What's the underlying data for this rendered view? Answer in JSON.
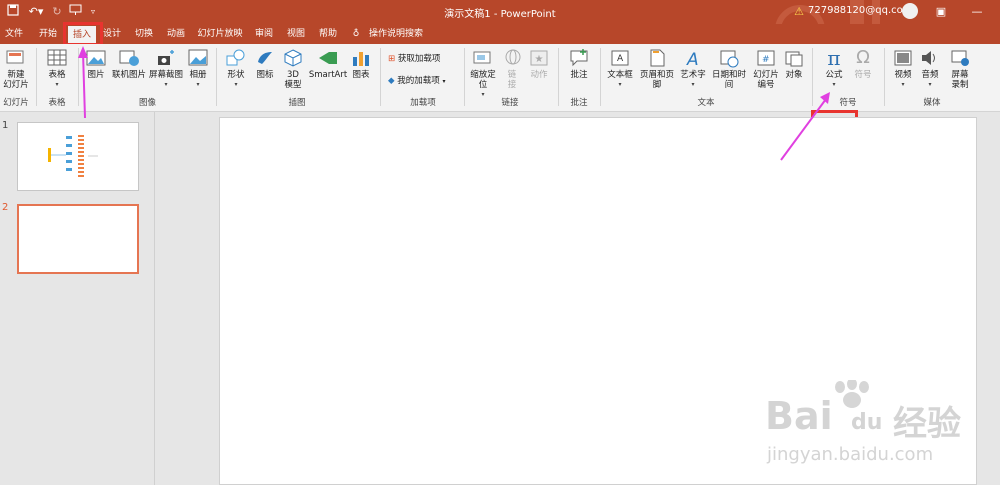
{
  "window": {
    "title": "演示文稿1 - PowerPoint",
    "account": "727988120@qq.com"
  },
  "quick_access": {
    "save": "save-icon",
    "undo": "undo-icon",
    "redo": "redo-icon",
    "present": "present-icon"
  },
  "menu_tabs": [
    "文件",
    "开始",
    "插入",
    "设计",
    "切换",
    "动画",
    "幻灯片放映",
    "审阅",
    "视图",
    "帮助"
  ],
  "search": {
    "label": "操作说明搜索"
  },
  "ribbon": {
    "slides": {
      "new_slide": "新建\n幻灯片",
      "group": "幻灯片"
    },
    "tables": {
      "table": "表格",
      "group": "表格"
    },
    "images": {
      "picture": "图片",
      "online_picture": "联机图片",
      "screenshot": "屏幕截图",
      "album": "相册",
      "group": "图像"
    },
    "illustrations": {
      "shapes": "形状",
      "icons": "图标",
      "3d": "3D\n模型",
      "smartart": "SmartArt",
      "chart": "图表",
      "group": "插图"
    },
    "addins": {
      "get": "获取加载项",
      "my": "我的加载项",
      "group": "加载项"
    },
    "links": {
      "zoom": "缩放定\n位",
      "link": "链\n接",
      "action": "动作",
      "group": "链接"
    },
    "comments": {
      "comment": "批注",
      "group": "批注"
    },
    "text": {
      "textbox": "文本框",
      "header_footer": "页眉和页脚",
      "wordart": "艺术字",
      "datetime": "日期和时间",
      "slide_number": "幻灯片\n编号",
      "object": "对象",
      "group": "文本"
    },
    "symbols": {
      "equation": "公式",
      "symbol": "符号",
      "group": "符号"
    },
    "media": {
      "video": "视频",
      "audio": "音频",
      "screen_recording": "屏幕\n录制",
      "group": "媒体"
    }
  },
  "slides": [
    {
      "number": "1"
    },
    {
      "number": "2"
    }
  ],
  "watermark": {
    "brand": "Bai",
    "brand2": "du",
    "cn": "经验",
    "url": "jingyan.baidu.com"
  },
  "colors": {
    "accent": "#b7472a",
    "highlight": "#e8342f",
    "pointer": "#e040e0"
  }
}
